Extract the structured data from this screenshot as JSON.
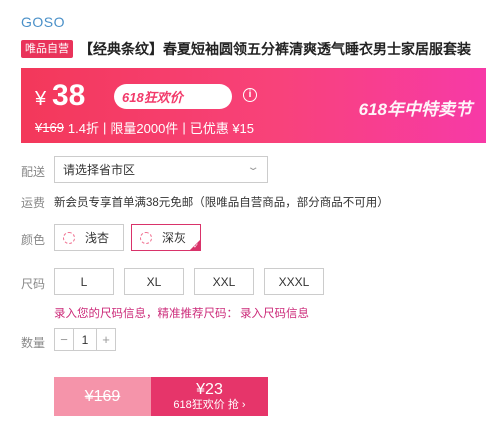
{
  "brand": "GOSO",
  "product": {
    "badge": "唯品自营",
    "title": "【经典条纹】春夏短袖圆领五分裤清爽透气睡衣男士家居服套装"
  },
  "price": {
    "currency": "¥",
    "current": "38",
    "promo_tag": "618狂欢价",
    "promo_price": "¥23",
    "info_icon": "i",
    "original": "¥169",
    "discount": "1.4折",
    "limit": "限量2000件",
    "saved": "已优惠 ¥15",
    "festival": "618年中特卖节",
    "separator": "|"
  },
  "delivery": {
    "label": "配送",
    "placeholder": "请选择省市区"
  },
  "shipping": {
    "label": "运费",
    "text": "新会员专享首单满38元免邮（限唯品自营商品，部分商品不可用）"
  },
  "color": {
    "label": "颜色",
    "options": [
      {
        "name": "浅杏",
        "selected": false
      },
      {
        "name": "深灰",
        "selected": true
      }
    ]
  },
  "size": {
    "label": "尺码",
    "options": [
      "L",
      "XL",
      "XXL",
      "XXXL"
    ],
    "hint": "录入您的尺码信息，精准推荐尺码：",
    "hint_link": "录入尺码信息"
  },
  "quantity": {
    "label": "数量",
    "minus": "−",
    "value": "1",
    "plus": "+"
  },
  "buy": {
    "original_price": "¥169",
    "promo_price": "¥23",
    "promo_action": "618狂欢价 抢 ›"
  },
  "colors": {
    "accent": "#e9335a",
    "brand_text": "#4a90c8",
    "hint_text": "#cc2b7a"
  }
}
